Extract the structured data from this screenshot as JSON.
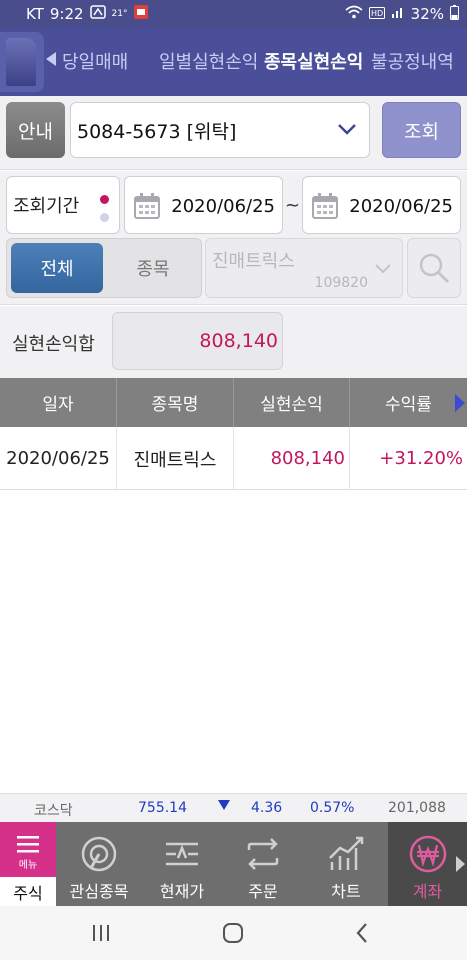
{
  "status_bar": {
    "carrier": "KT",
    "time": "9:22",
    "temperature": "21°",
    "battery": "32%"
  },
  "tabs": [
    {
      "label": "당일매매"
    },
    {
      "label": "일별실현손익"
    },
    {
      "label": "종목실현손익"
    },
    {
      "label": "불공정내역"
    }
  ],
  "query": {
    "guide_label": "안내",
    "account": "5084-5673 [위탁]",
    "search_label": "조회"
  },
  "period": {
    "label": "조회기간",
    "start_date": "2020/06/25",
    "separator": "~",
    "end_date": "2020/06/25"
  },
  "filter": {
    "all_label": "전체",
    "stock_label": "종목",
    "stock_name": "진매트릭스",
    "stock_code": "109820"
  },
  "summary": {
    "label": "실현손익합",
    "value": "808,140"
  },
  "table": {
    "columns": [
      "일자",
      "종목명",
      "실현손익",
      "수익률"
    ],
    "rows": [
      {
        "date": "2020/06/25",
        "name": "진매트릭스",
        "profit": "808,140",
        "rate": "+31.20%"
      }
    ]
  },
  "ticker": {
    "name": "코스닥",
    "index": "755.14",
    "change": "4.36",
    "percent": "0.57%",
    "volume": "201,088"
  },
  "bottom_menu": {
    "menu_label": "메뉴",
    "stock_label": "주식",
    "items": [
      {
        "label": "관심종목"
      },
      {
        "label": "현재가"
      },
      {
        "label": "주문"
      },
      {
        "label": "차트"
      },
      {
        "label": "계좌"
      }
    ]
  },
  "colors": {
    "header": "#4b4f99",
    "accent": "#c2185b",
    "down": "#1f3cbf"
  }
}
